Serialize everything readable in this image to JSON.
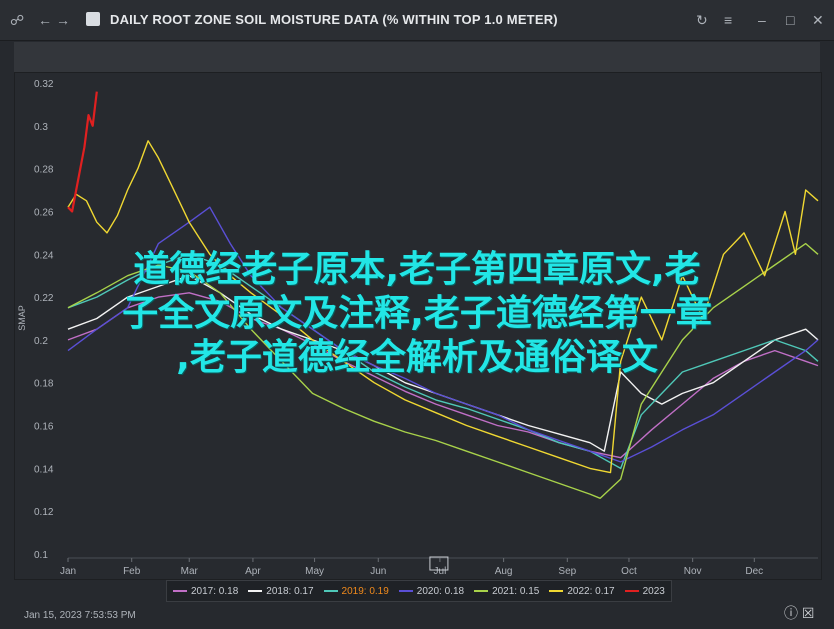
{
  "window": {
    "title": "DAILY ROOT ZONE SOIL MOISTURE DATA (% WITHIN TOP 1.0 METER)",
    "timestamp": "Jan 15, 2023 7:53:53 PM"
  },
  "overlay_text": [
    "道德经老子原本,老子第四章原文,老",
    "子全文原文及注释,老子道德经第一章",
    ",老子道德经全解析及通俗译文"
  ],
  "colors": {
    "2017": "#c06fc6",
    "2018": "#f2f2f2",
    "2019": "#4fc8b8",
    "2020": "#5a4fd6",
    "2021": "#a8d24a",
    "2022": "#f0d832",
    "2023": "#e02020"
  },
  "chart_data": {
    "type": "line",
    "title": "DAILY ROOT ZONE SOIL MOISTURE DATA (% WITHIN TOP 1.0 METER)",
    "ylabel": "SMAP",
    "xlabel": "",
    "ylim": [
      0.1,
      0.32
    ],
    "yticks": [
      "0.32",
      "0.3",
      "0.28",
      "0.26",
      "0.24",
      "0.22",
      "0.2",
      "0.18",
      "0.16",
      "0.14",
      "0.12",
      "0.1"
    ],
    "ytick_values": [
      0.32,
      0.3,
      0.28,
      0.26,
      0.24,
      0.22,
      0.2,
      0.18,
      0.16,
      0.14,
      0.12,
      0.1
    ],
    "months": [
      "Jan",
      "Feb",
      "Mar",
      "Apr",
      "May",
      "Jun",
      "Jul",
      "Aug",
      "Sep",
      "Oct",
      "Nov",
      "Dec"
    ],
    "month_days": [
      1,
      32,
      60,
      91,
      121,
      152,
      182,
      213,
      244,
      274,
      305,
      335
    ],
    "xlim": [
      1,
      366
    ],
    "highlight_label": "Jul",
    "grid": false,
    "legend_position": "bottom",
    "series": [
      {
        "name": "2017: 0.18",
        "color_key": "2017",
        "x": [
          1,
          15,
          30,
          45,
          60,
          75,
          90,
          105,
          120,
          135,
          150,
          165,
          180,
          195,
          210,
          225,
          240,
          255,
          270,
          285,
          300,
          315,
          330,
          345,
          360,
          366
        ],
        "y": [
          0.2,
          0.205,
          0.215,
          0.22,
          0.222,
          0.218,
          0.21,
          0.205,
          0.198,
          0.19,
          0.183,
          0.176,
          0.17,
          0.165,
          0.16,
          0.157,
          0.152,
          0.148,
          0.145,
          0.158,
          0.17,
          0.182,
          0.19,
          0.195,
          0.19,
          0.188
        ]
      },
      {
        "name": "2018: 0.17",
        "color_key": "2018",
        "x": [
          1,
          15,
          30,
          45,
          60,
          75,
          90,
          105,
          120,
          135,
          150,
          165,
          180,
          195,
          210,
          225,
          240,
          255,
          262,
          270,
          275,
          280,
          290,
          300,
          315,
          330,
          345,
          360,
          366
        ],
        "y": [
          0.205,
          0.21,
          0.22,
          0.225,
          0.23,
          0.222,
          0.212,
          0.205,
          0.2,
          0.195,
          0.188,
          0.18,
          0.175,
          0.17,
          0.165,
          0.16,
          0.156,
          0.152,
          0.148,
          0.185,
          0.18,
          0.175,
          0.17,
          0.175,
          0.18,
          0.19,
          0.2,
          0.205,
          0.2
        ]
      },
      {
        "name": "2019: 0.19",
        "color_key": "2019",
        "x": [
          1,
          15,
          30,
          45,
          60,
          75,
          90,
          105,
          120,
          135,
          150,
          165,
          180,
          195,
          210,
          225,
          240,
          255,
          270,
          280,
          290,
          300,
          315,
          330,
          345,
          360,
          366
        ],
        "y": [
          0.215,
          0.22,
          0.228,
          0.235,
          0.24,
          0.235,
          0.225,
          0.215,
          0.205,
          0.195,
          0.185,
          0.178,
          0.172,
          0.168,
          0.163,
          0.158,
          0.152,
          0.148,
          0.14,
          0.165,
          0.175,
          0.185,
          0.19,
          0.195,
          0.2,
          0.195,
          0.19
        ]
      },
      {
        "name": "2020: 0.18",
        "color_key": "2020",
        "x": [
          1,
          15,
          30,
          45,
          60,
          70,
          80,
          90,
          105,
          120,
          135,
          150,
          165,
          180,
          195,
          210,
          225,
          240,
          255,
          270,
          285,
          300,
          315,
          330,
          345,
          360,
          366
        ],
        "y": [
          0.195,
          0.205,
          0.215,
          0.245,
          0.255,
          0.262,
          0.245,
          0.23,
          0.215,
          0.205,
          0.195,
          0.188,
          0.182,
          0.175,
          0.17,
          0.165,
          0.158,
          0.153,
          0.148,
          0.143,
          0.15,
          0.158,
          0.165,
          0.175,
          0.185,
          0.195,
          0.2
        ]
      },
      {
        "name": "2021: 0.15",
        "color_key": "2021",
        "x": [
          1,
          15,
          30,
          45,
          60,
          75,
          90,
          105,
          120,
          135,
          150,
          165,
          180,
          195,
          210,
          225,
          240,
          255,
          260,
          270,
          280,
          290,
          300,
          315,
          330,
          345,
          360,
          366
        ],
        "y": [
          0.215,
          0.222,
          0.23,
          0.235,
          0.232,
          0.222,
          0.205,
          0.19,
          0.175,
          0.168,
          0.162,
          0.157,
          0.153,
          0.148,
          0.143,
          0.138,
          0.133,
          0.128,
          0.126,
          0.135,
          0.17,
          0.185,
          0.2,
          0.215,
          0.225,
          0.235,
          0.245,
          0.24
        ]
      },
      {
        "name": "2022: 0.17",
        "color_key": "2022",
        "x": [
          1,
          5,
          10,
          15,
          20,
          25,
          30,
          35,
          40,
          45,
          50,
          55,
          60,
          70,
          80,
          90,
          100,
          110,
          120,
          135,
          150,
          165,
          180,
          195,
          210,
          225,
          240,
          255,
          265,
          270,
          280,
          290,
          300,
          310,
          320,
          330,
          340,
          350,
          355,
          360,
          366
        ],
        "y": [
          0.262,
          0.268,
          0.265,
          0.255,
          0.25,
          0.258,
          0.27,
          0.28,
          0.293,
          0.285,
          0.275,
          0.265,
          0.255,
          0.24,
          0.23,
          0.222,
          0.215,
          0.208,
          0.2,
          0.19,
          0.18,
          0.172,
          0.166,
          0.16,
          0.155,
          0.15,
          0.145,
          0.14,
          0.138,
          0.19,
          0.22,
          0.2,
          0.23,
          0.21,
          0.24,
          0.25,
          0.23,
          0.26,
          0.24,
          0.27,
          0.265
        ]
      },
      {
        "name": "2023",
        "color_key": "2023",
        "x": [
          1,
          3,
          5,
          7,
          9,
          11,
          13,
          15
        ],
        "y": [
          0.262,
          0.26,
          0.27,
          0.28,
          0.29,
          0.305,
          0.3,
          0.316
        ]
      }
    ]
  }
}
